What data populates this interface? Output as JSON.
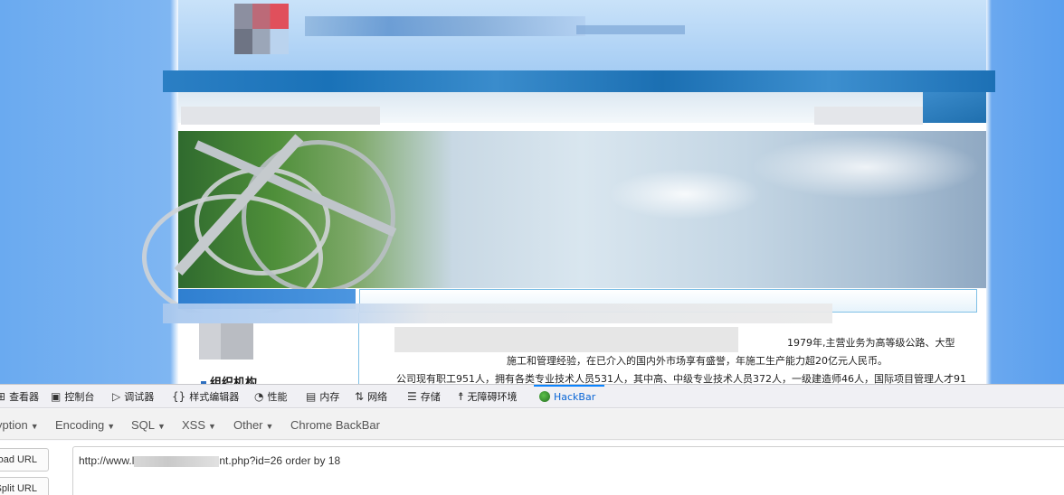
{
  "website": {
    "left_heading": "组织机构",
    "paragraph_line1": "1979年,主营业务为高等级公路、大型",
    "paragraph_line2": "施工和管理经验，在已介入的国内外市场享有盛誉，年施工生产能力超20亿元人民币。",
    "paragraph_line3": "公司现有职工951人，拥有各类专业技术人员531人，其中高、中级专业技术人员372人，一级建造师46人，国际项目管理人才91"
  },
  "devtools": {
    "tabs": [
      {
        "icon": "inspector-icon",
        "glyph": "⊞",
        "label": "查看器"
      },
      {
        "icon": "console-icon",
        "glyph": "▣",
        "label": "控制台"
      },
      {
        "icon": "debugger-icon",
        "glyph": "▷",
        "label": "调试器"
      },
      {
        "icon": "style-editor-icon",
        "glyph": "{}",
        "label": "样式编辑器"
      },
      {
        "icon": "performance-icon",
        "glyph": "◔",
        "label": "性能"
      },
      {
        "icon": "memory-icon",
        "glyph": "▤",
        "label": "内存"
      },
      {
        "icon": "network-icon",
        "glyph": "⇅",
        "label": "网络"
      },
      {
        "icon": "storage-icon",
        "glyph": "☰",
        "label": "存储"
      },
      {
        "icon": "accessibility-icon",
        "glyph": "☨",
        "label": "无障碍环境"
      },
      {
        "icon": "hackbar-icon",
        "glyph": "",
        "label": "HackBar"
      }
    ],
    "active_tab": "HackBar",
    "accent_color": "#0a84ff"
  },
  "hackbar": {
    "menu": [
      {
        "label": "yption",
        "has_caret": true
      },
      {
        "label": "Encoding",
        "has_caret": true
      },
      {
        "label": "SQL",
        "has_caret": true
      },
      {
        "label": "XSS",
        "has_caret": true
      },
      {
        "label": "Other",
        "has_caret": true
      },
      {
        "label": "Chrome BackBar",
        "has_caret": false
      }
    ],
    "buttons": {
      "load_url": "oad URL",
      "split_url": "Split URL"
    },
    "url_prefix": "http://www.l",
    "url_suffix": "nt.php?id=26 order by 18"
  }
}
